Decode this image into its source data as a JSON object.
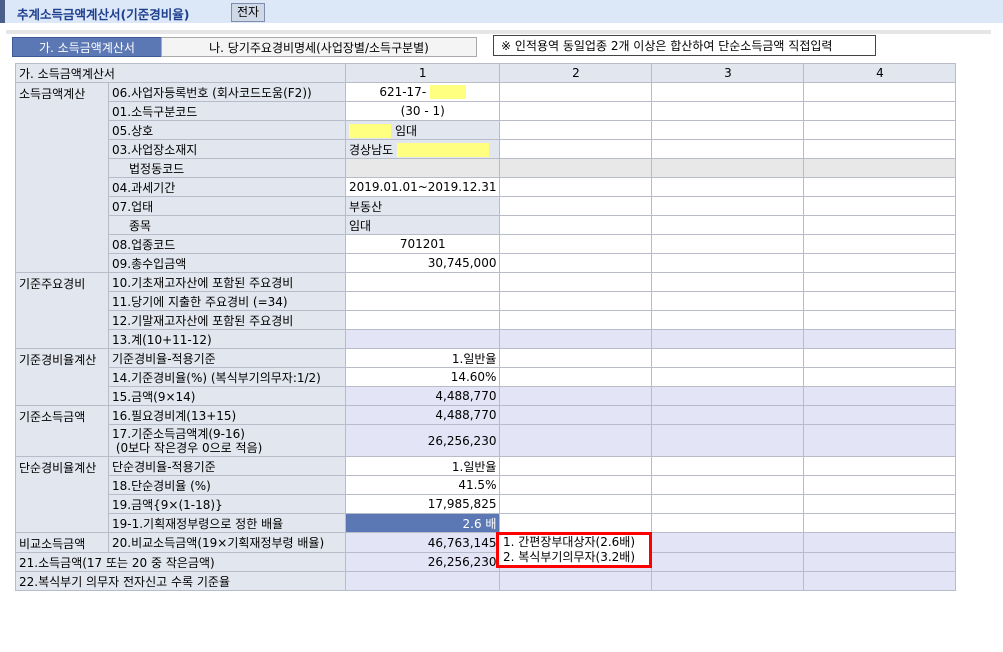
{
  "window": {
    "title": "추계소득금액계산서(기준경비율)",
    "e_button": "전자"
  },
  "tabs": [
    {
      "label": "가. 소득금액계산서",
      "active": true
    },
    {
      "label": "나. 당기주요경비명세(사업장별/소득구분별)",
      "active": false
    }
  ],
  "note": "※ 인적용역 동일업종 2개 이상은 합산하여 단순소득금액 직접입력",
  "table": {
    "header": {
      "title": "가. 소득금액계산서",
      "columns": [
        "1",
        "2",
        "3",
        "4"
      ]
    },
    "groups": [
      {
        "label": "소득금액계산",
        "rows": [
          {
            "label": "06.사업자등록번호 (회사코드도움(F2))",
            "value": "621-17-",
            "align": "c",
            "yellow": "after"
          },
          {
            "label": "01.소득구분코드",
            "value": "(30 - 1)",
            "align": "c"
          },
          {
            "label": "05.상호",
            "value": "임대",
            "align": "l",
            "yellow": "before"
          },
          {
            "label": "03.사업장소재지",
            "value": "경상남도",
            "align": "l",
            "yellow": "after"
          },
          {
            "label": "법정동코드",
            "value": "",
            "indent": true,
            "style": "gr"
          },
          {
            "label": "04.과세기간",
            "value": "2019.01.01~2019.12.31",
            "align": "c"
          },
          {
            "label": "07.업태",
            "value": "부동산",
            "align": "l"
          },
          {
            "label": "종목",
            "value": "임대",
            "align": "l",
            "indent": true
          },
          {
            "label": "08.업종코드",
            "value": "701201",
            "align": "c"
          },
          {
            "label": "09.총수입금액",
            "value": "30,745,000",
            "align": "r"
          }
        ]
      },
      {
        "label": "기준주요경비",
        "rows": [
          {
            "label": "10.기초재고자산에 포함된 주요경비",
            "value": ""
          },
          {
            "label": "11.당기에 지출한 주요경비 (=34)",
            "value": ""
          },
          {
            "label": "12.기말재고자산에 포함된 주요경비",
            "value": ""
          },
          {
            "label": "13.계(10+11-12)",
            "value": "",
            "style": "cp"
          }
        ]
      },
      {
        "label": "기준경비율계산",
        "rows": [
          {
            "label": "기준경비율-적용기준",
            "value": "1.일반율",
            "align": "r"
          },
          {
            "label": "14.기준경비율(%) (복식부기의무자:1/2)",
            "value": "14.60%",
            "align": "r"
          },
          {
            "label": "15.금액(9×14)",
            "value": "4,488,770",
            "align": "r",
            "style": "cp"
          }
        ]
      },
      {
        "label": "기준소득금액",
        "rows": [
          {
            "label": "16.필요경비계(13+15)",
            "value": "4,488,770",
            "align": "r",
            "style": "cp"
          },
          {
            "label": "17.기준소득금액계(9-16)\n (0보다 작은경우 0으로 적음)",
            "value": "26,256,230",
            "align": "r",
            "style": "cp",
            "tall": true
          }
        ]
      },
      {
        "label": "단순경비율계산",
        "rows": [
          {
            "label": "단순경비율-적용기준",
            "value": "1.일반율",
            "align": "r"
          },
          {
            "label": "18.단순경비율 (%)",
            "value": "41.5%",
            "align": "r"
          },
          {
            "label": "19.금액{9×(1-18)}",
            "value": "17,985,825",
            "align": "r"
          },
          {
            "label": "19-1.기획재정부령으로 정한 배율",
            "value": "2.6 배",
            "align": "r",
            "selected": true
          }
        ]
      },
      {
        "label": "비교소득금액",
        "rows": [
          {
            "label": "20.비교소득금액(19×기획재정부령 배율)",
            "value": "46,763,145",
            "align": "r",
            "style": "cp"
          }
        ]
      }
    ],
    "full_rows": [
      {
        "label": "21.소득금액(17 또는 20 중 작은금액)",
        "value": "26,256,230",
        "style": "cp"
      },
      {
        "label": "22.복식부기 의무자 전자신고 수록 기준율",
        "value": "",
        "style": "cp"
      }
    ]
  },
  "popup": {
    "options": [
      "1. 간편장부대상자(2.6배)",
      "2. 복식부기의무자(3.2배)"
    ]
  }
}
